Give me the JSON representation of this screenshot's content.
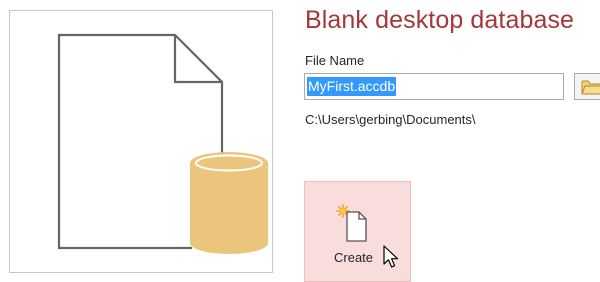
{
  "dialog": {
    "title": "Blank desktop database",
    "file_name_label": "File Name",
    "file_name_value": "MyFirst.accdb",
    "path": "C:\\Users\\gerbing\\Documents\\",
    "create_label": "Create"
  },
  "icons": {
    "preview": "blank-database-icon",
    "browse": "folder-icon",
    "create": "new-document-icon",
    "cursor": "mouse-pointer-icon"
  },
  "colors": {
    "title": "#a4373a",
    "selection": "#3399ff",
    "create_bg": "#f9dcdc",
    "cylinder": "#ecc57d"
  }
}
